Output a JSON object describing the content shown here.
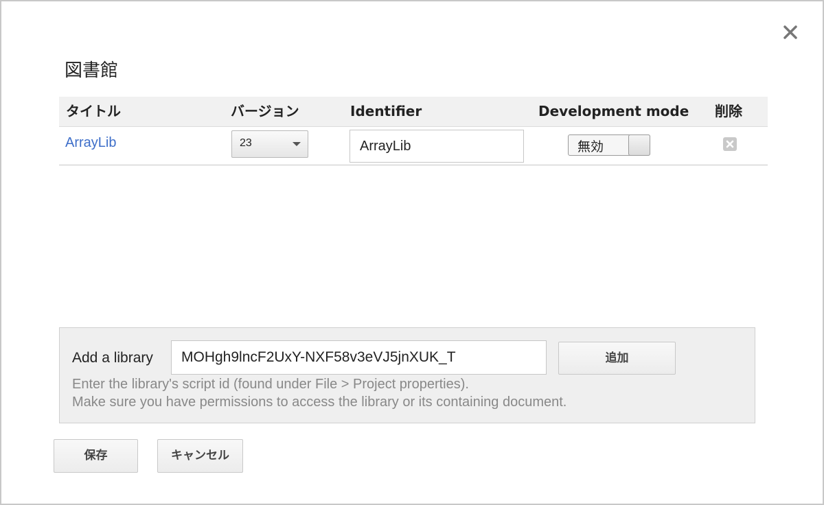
{
  "dialog": {
    "title": "図書館",
    "close_icon": "close-icon"
  },
  "table": {
    "headers": {
      "title": "タイトル",
      "version": "バージョン",
      "identifier": "Identifier",
      "development_mode": "Development mode",
      "delete": "削除"
    },
    "rows": [
      {
        "title": "ArrayLib",
        "version": "23",
        "identifier": "ArrayLib",
        "development_mode": "無効",
        "delete_icon": "delete-x-icon"
      }
    ]
  },
  "add_library": {
    "label": "Add a library",
    "input_value": "MOHgh9lncF2UxY-NXF58v3eVJ5jnXUK_T",
    "button_label": "追加",
    "hint_line1": "Enter the library's script id (found under File > Project properties).",
    "hint_line2": "Make sure you have permissions to access the library or its containing document."
  },
  "footer": {
    "save_label": "保存",
    "cancel_label": "キャンセル"
  },
  "colors": {
    "link": "#3d6ec9",
    "header_bg": "#f1f1f1",
    "panel_bg": "#efefef",
    "hint_text": "#888888"
  }
}
